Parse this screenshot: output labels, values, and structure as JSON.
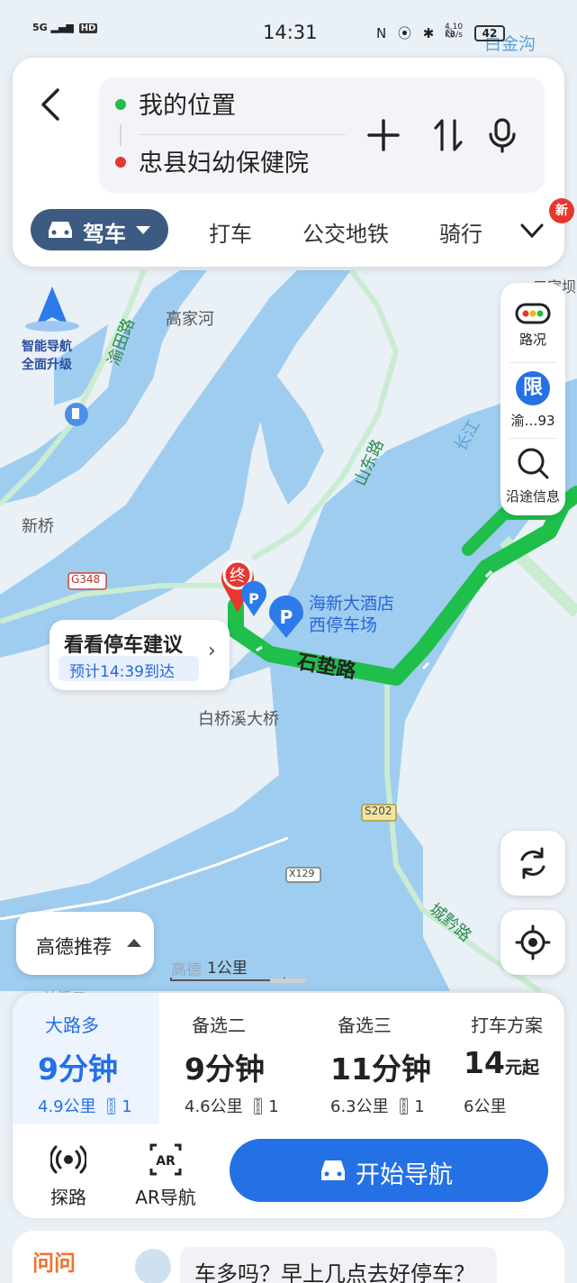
{
  "status_bar": {
    "network": "5G",
    "hd": "HD",
    "time": "14:31",
    "icons": "N ⦿ ✱ ⍉",
    "speed_value": "4.10",
    "speed_unit": "KB/s",
    "battery": "42"
  },
  "search": {
    "origin": "我的位置",
    "destination": "忠县妇幼保健院"
  },
  "modes": {
    "active": "驾车",
    "taxi": "打车",
    "transit": "公交地铁",
    "bike": "骑行",
    "new_badge": "新"
  },
  "side_panel": {
    "traffic_label": "路况",
    "limit_badge": "限",
    "limit_label": "渝…93",
    "along_label": "沿途信息"
  },
  "map": {
    "labels": {
      "gaojiahe": "高家河",
      "yutian_road": "渝田路",
      "shandong_road": "山东路",
      "changjiang": "长江",
      "xinqiao": "新桥",
      "g348": "G348",
      "end_marker": "终",
      "parking_name": "海新大酒店\n西停车场",
      "shidian_road": "石垫路",
      "baiqiaoxi": "白桥溪大桥",
      "s202": "S202",
      "x129": "X129",
      "chengqian_road": "城黔路",
      "baijingou": "白金沟",
      "scale": "1公里",
      "gaode": "高德",
      "shenxikou": "神溪口",
      "sanjiaoba": "三家坝"
    },
    "badge": {
      "line1": "智能导航",
      "line2": "全面升级"
    }
  },
  "parking_tip": {
    "title": "看看停车建议",
    "eta": "预计14:39到达"
  },
  "recommend": {
    "label": "高德推荐"
  },
  "routes": [
    {
      "name": "大路多",
      "time_value": "9",
      "time_unit": "分钟",
      "distance": "4.9公里",
      "lights": "1"
    },
    {
      "name": "备选二",
      "time_value": "9",
      "time_unit": "分钟",
      "distance": "4.6公里",
      "lights": "1"
    },
    {
      "name": "备选三",
      "time_value": "11",
      "time_unit": "分钟",
      "distance": "6.3公里",
      "lights": "1"
    },
    {
      "name": "打车方案",
      "time_value": "14",
      "time_unit": "元起",
      "distance": "6公里"
    }
  ],
  "tools": {
    "explore": "探路",
    "ar_nav": "AR导航",
    "ar_icon_text": "AR",
    "start": "开始导航"
  },
  "ask": {
    "logo": "问问",
    "question": "车多吗？早上几点去好停车？"
  },
  "colors": {
    "route_green": "#1fbf4b",
    "water": "#9fcdf0",
    "land": "#eaf1f7",
    "accent_blue": "#2470e5",
    "mode_active": "#3d5a82",
    "end_red": "#e8372f"
  }
}
